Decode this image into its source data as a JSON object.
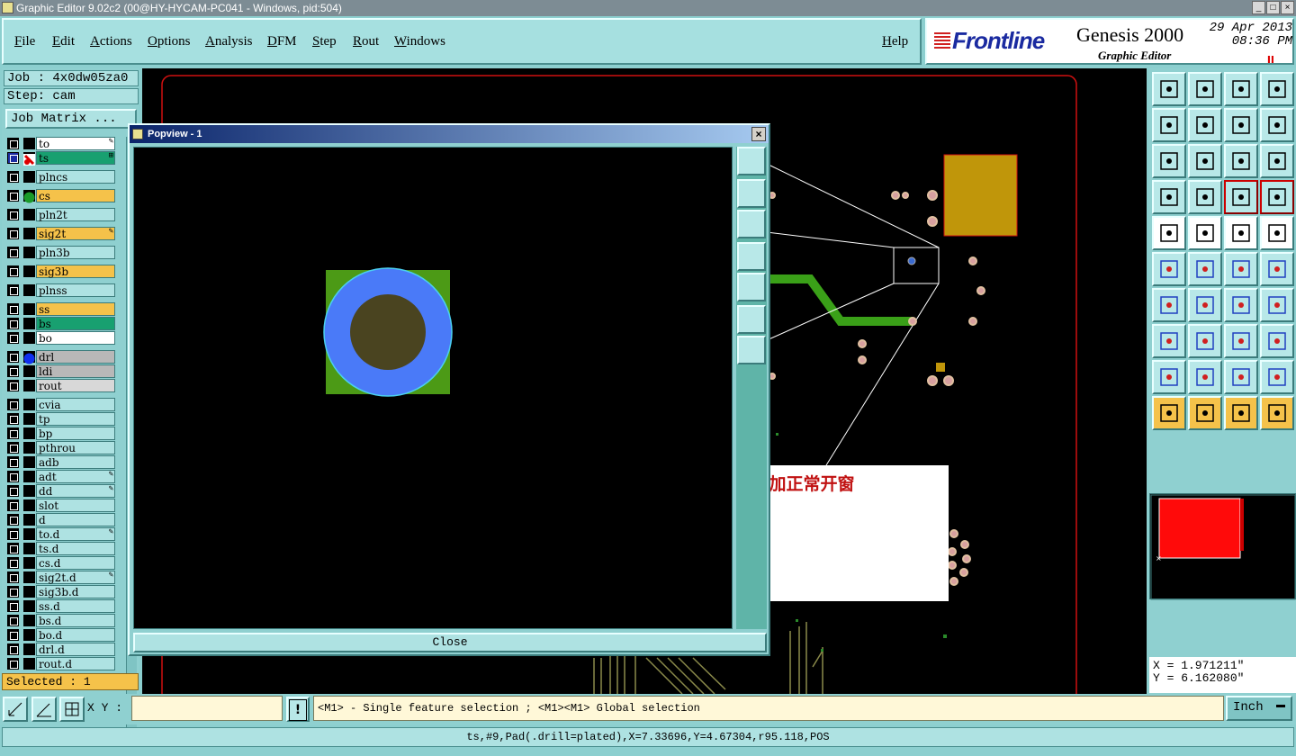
{
  "window": {
    "title": "Graphic Editor 9.02c2 (00@HY-HYCAM-PC041 - Windows, pid:504)",
    "btn_min": "_",
    "btn_max": "□",
    "btn_close": "×"
  },
  "menu": {
    "items": [
      "File",
      "Edit",
      "Actions",
      "Options",
      "Analysis",
      "DFM",
      "Step",
      "Rout",
      "Windows"
    ],
    "help": "Help"
  },
  "brand": {
    "logo": "Frontline",
    "product": "Genesis 2000",
    "subtitle": "Graphic Editor",
    "date": "29 Apr 2013",
    "time": "08:36 PM",
    "pause": "II"
  },
  "job": {
    "job": "Job : 4x0dw05za0",
    "step": "Step: cam",
    "matrix": "Job Matrix ..."
  },
  "layers": [
    {
      "name": "to",
      "color": "#ffffff",
      "mark": "✎"
    },
    {
      "name": "ts",
      "color": "#18a070",
      "mark": "⊞",
      "affected": true
    },
    {
      "name": "plncs",
      "color": "#aee2e2"
    },
    {
      "name": "cs",
      "color": "#f5c24a",
      "dot": "#1a9a2a"
    },
    {
      "name": "pln2t",
      "color": "#aee2e2"
    },
    {
      "name": "sig2t",
      "color": "#f5c24a",
      "mark": "✎"
    },
    {
      "name": "pln3b",
      "color": "#aee2e2"
    },
    {
      "name": "sig3b",
      "color": "#f5c24a"
    },
    {
      "name": "plnss",
      "color": "#aee2e2"
    },
    {
      "name": "ss",
      "color": "#f5c24a"
    },
    {
      "name": "bs",
      "color": "#18a070"
    },
    {
      "name": "bo",
      "color": "#ffffff"
    },
    {
      "name": "drl",
      "color": "#b8b8b8",
      "dot": "#1030f0"
    },
    {
      "name": "ldi",
      "color": "#b8b8b8"
    },
    {
      "name": "rout",
      "color": "#d8d8d8"
    },
    {
      "name": "cvia",
      "color": "#aee2e2"
    },
    {
      "name": "tp",
      "color": "#aee2e2"
    },
    {
      "name": "bp",
      "color": "#aee2e2"
    },
    {
      "name": "pthrou",
      "color": "#aee2e2"
    },
    {
      "name": "adb",
      "color": "#aee2e2"
    },
    {
      "name": "adt",
      "color": "#aee2e2",
      "mark": "✎"
    },
    {
      "name": "dd",
      "color": "#aee2e2",
      "mark": "✎"
    },
    {
      "name": "slot",
      "color": "#aee2e2"
    },
    {
      "name": "d",
      "color": "#aee2e2"
    },
    {
      "name": "to.d",
      "color": "#aee2e2",
      "mark": "✎"
    },
    {
      "name": "ts.d",
      "color": "#aee2e2"
    },
    {
      "name": "cs.d",
      "color": "#aee2e2"
    },
    {
      "name": "sig2t.d",
      "color": "#aee2e2",
      "mark": "✎"
    },
    {
      "name": "sig3b.d",
      "color": "#aee2e2"
    },
    {
      "name": "ss.d",
      "color": "#aee2e2"
    },
    {
      "name": "bs.d",
      "color": "#aee2e2"
    },
    {
      "name": "bo.d",
      "color": "#aee2e2"
    },
    {
      "name": "drl.d",
      "color": "#aee2e2"
    },
    {
      "name": "rout.d",
      "color": "#aee2e2"
    }
  ],
  "selected": "Selected : 1",
  "popup": {
    "title": "Popview - 1",
    "close": "Close",
    "close_x": "×"
  },
  "note": "预审指示加正常开窗",
  "coords": {
    "x": "X = 1.971211\"",
    "y": "Y = 6.162080\""
  },
  "bottom": {
    "xy_label": "X Y :",
    "xy_value": "",
    "message": "<M1> - Single feature selection ; <M1><M1> Global selection",
    "units": "Inch",
    "bang": "!"
  },
  "status": "ts,#9,Pad(.drill=plated),X=7.33696,Y=4.67304,r95.118,POS"
}
